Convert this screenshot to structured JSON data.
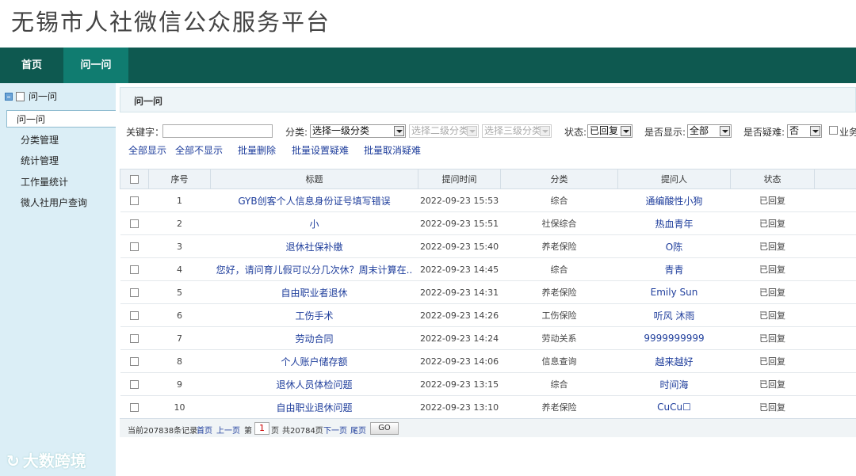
{
  "header": {
    "title": "无锡市人社微信公众服务平台"
  },
  "nav": {
    "home": "首页",
    "qa": "问一问"
  },
  "sidebar": {
    "tree_title": "问一问",
    "items": [
      {
        "label": "问一问"
      },
      {
        "label": "分类管理"
      },
      {
        "label": "统计管理"
      },
      {
        "label": "工作量统计"
      },
      {
        "label": "微人社用户查询"
      }
    ]
  },
  "content": {
    "section_title": "问一问"
  },
  "filters": {
    "keyword_label": "关键字：",
    "keyword_value": "",
    "category_label": "分类:",
    "cat1": "选择一级分类",
    "cat2": "选择二级分类",
    "cat3": "选择三级分类",
    "status_label": "状态:",
    "status_value": "已回复",
    "show_label": "是否显示:",
    "show_value": "全部",
    "difficult_label": "是否疑难:",
    "difficult_value": "否",
    "business_label": "业务"
  },
  "actions": {
    "show_all": "全部显示",
    "hide_all": "全部不显示",
    "batch_delete": "批量删除",
    "batch_set_difficult": "批量设置疑难",
    "batch_cancel_difficult": "批量取消疑难"
  },
  "table": {
    "columns": [
      "序号",
      "标题",
      "提问时间",
      "分类",
      "提问人",
      "状态"
    ],
    "rows": [
      {
        "no": "1",
        "title": "GYB创客个人信息身份证号填写错误",
        "time": "2022-09-23 15:53",
        "category": "综合",
        "asker": "通编酸性小狗",
        "status": "已回复"
      },
      {
        "no": "2",
        "title": "小",
        "time": "2022-09-23 15:51",
        "category": "社保综合",
        "asker": "热血青年",
        "status": "已回复"
      },
      {
        "no": "3",
        "title": "退休社保补缴",
        "time": "2022-09-23 15:40",
        "category": "养老保险",
        "asker": "O陈",
        "status": "已回复"
      },
      {
        "no": "4",
        "title": "您好，请问育儿假可以分几次休？周末计算在..",
        "time": "2022-09-23 14:45",
        "category": "综合",
        "asker": "青青",
        "status": "已回复"
      },
      {
        "no": "5",
        "title": "自由职业者退休",
        "time": "2022-09-23 14:31",
        "category": "养老保险",
        "asker": "Emily Sun",
        "status": "已回复"
      },
      {
        "no": "6",
        "title": "工伤手术",
        "time": "2022-09-23 14:26",
        "category": "工伤保险",
        "asker": "听风 沐雨",
        "status": "已回复"
      },
      {
        "no": "7",
        "title": "劳动合同",
        "time": "2022-09-23 14:24",
        "category": "劳动关系",
        "asker": "9999999999",
        "status": "已回复"
      },
      {
        "no": "8",
        "title": "个人账户储存额",
        "time": "2022-09-23 14:06",
        "category": "信息查询",
        "asker": "越来越好",
        "status": "已回复"
      },
      {
        "no": "9",
        "title": "退休人员体检问题",
        "time": "2022-09-23 13:15",
        "category": "综合",
        "asker": "时间海",
        "status": "已回复"
      },
      {
        "no": "10",
        "title": "自由职业退休问题",
        "time": "2022-09-23 13:10",
        "category": "养老保险",
        "asker": "CuCu☐",
        "status": "已回复"
      }
    ]
  },
  "pager": {
    "summary": "当前207838条记录",
    "first": "首页",
    "prev": "上一页",
    "page_prefix": "第",
    "page_value": "1",
    "page_suffix": "页",
    "total_pages": "共20784页",
    "next": "下一页",
    "last": "尾页",
    "go": "GO"
  },
  "watermark": {
    "text": "大数跨境"
  }
}
